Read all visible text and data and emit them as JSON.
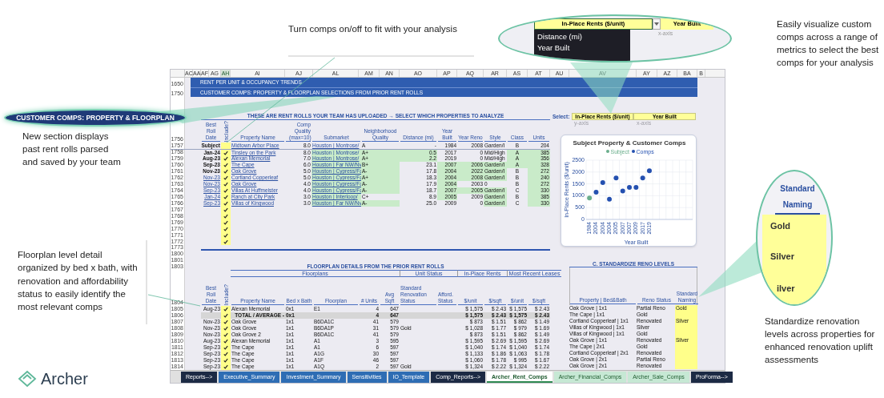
{
  "annotations": {
    "section_label": "CUSTOMER COMPS: PROPERTY & FLOORPLAN",
    "new_section_note": "New section displays past rent rolls parsed and saved by your team",
    "comps_toggle_note": "Turn comps on/off to fit with your analysis",
    "visualize_note": "Easily visualize custom comps across a range of metrics to select the best comps for your analysis",
    "floorplan_note": "Floorplan level detail organized by bed x bath, with renovation and affordability status to easily identify the most relevant comps",
    "standardize_note": "Standardize renovation levels across properties for enhanced renovation uplift assessments"
  },
  "axis_callout": {
    "y_field": "In-Place Rents ($/unit)",
    "x_field": "Year Built",
    "x_hint": "x-axis",
    "menu": [
      "Distance (mi)",
      "Year Built"
    ]
  },
  "naming_callout": {
    "header": "Standard Naming",
    "values": [
      "Gold",
      "Silver",
      "ilver"
    ]
  },
  "logo": {
    "name": "Archer"
  },
  "sheet": {
    "columns": [
      "AC",
      "AA",
      "AF",
      "AG",
      "AH",
      "AI",
      "AJ",
      "AL",
      "AM",
      "AN",
      "AO",
      "AP",
      "AQ",
      "AR",
      "AS",
      "AT",
      "AU",
      "AV",
      "AY",
      "AZ",
      "BA",
      "B"
    ],
    "banners": [
      {
        "row": "1650",
        "text": "RENT PER UNIT & OCCUPANCY TRENDS"
      },
      {
        "row": "1750",
        "text": "CUSTOMER COMPS: PROPERTY & FLOORPLAN SELECTIONS FROM PRIOR RENT ROLLS"
      }
    ],
    "comps": {
      "title": "THESE ARE RENT ROLLS YOUR TEAM HAS UPLOADED  →  SELECT WHICH PROPERTIES TO ANALYZE",
      "header_row": "1756",
      "headers": [
        "Best Roll Date",
        "Include?",
        "Property Name",
        "Comp Quality (max=10)",
        "Submarket",
        "Neighborhood Quality",
        "Distance (mi)",
        "Year Built",
        "Year Reno",
        "Style",
        "Class",
        "Units"
      ],
      "rows": [
        {
          "row": "1757",
          "date": "Subject",
          "linked": false,
          "included": false,
          "property": "Midtown Arbor Place",
          "quality": "8.0",
          "submarket": "Houston | Montrose/",
          "neighborhood": "A",
          "distance": "-",
          "year_built": "1984",
          "year_reno": "2008",
          "style": "Garden/I",
          "class": "B",
          "units": "204",
          "highlighted": [
            false,
            false,
            false,
            false,
            false,
            false,
            false,
            false,
            false,
            false
          ]
        },
        {
          "row": "1758",
          "date": "Jan-24",
          "linked": false,
          "included": true,
          "property": "Tinsley on the Park",
          "quality": "8.0",
          "submarket": "Houston | Montrose/",
          "neighborhood": "A+",
          "distance": "0.5",
          "year_built": "2017",
          "year_reno": "0",
          "style": "Mid/High",
          "class": "A",
          "units": "385",
          "highlighted": [
            false,
            false,
            true,
            true,
            true,
            false,
            false,
            false,
            true,
            true
          ]
        },
        {
          "row": "1759",
          "date": "Aug-23",
          "linked": false,
          "included": true,
          "property": "Alexan Memorial",
          "quality": "7.0",
          "submarket": "Houston | Montrose/",
          "neighborhood": "A+",
          "distance": "2.2",
          "year_built": "2019",
          "year_reno": "0",
          "style": "Mid/High",
          "class": "A",
          "units": "356",
          "highlighted": [
            false,
            false,
            true,
            true,
            true,
            false,
            false,
            false,
            true,
            true
          ]
        },
        {
          "row": "1760",
          "date": "Sep-23",
          "linked": false,
          "included": true,
          "property": "The Cape",
          "quality": "6.0",
          "submarket": "Houston | Far NW/Nv",
          "neighborhood": "B+",
          "distance": "23.1",
          "year_built": "2007",
          "year_reno": "2006",
          "style": "Garden/I",
          "class": "A",
          "units": "328",
          "highlighted": [
            false,
            false,
            true,
            true,
            false,
            true,
            true,
            true,
            true,
            true
          ]
        },
        {
          "row": "1761",
          "date": "Nov-23",
          "linked": false,
          "included": true,
          "property": "Oak Grove",
          "quality": "5.0",
          "submarket": "Houston | Cypress/Fa",
          "neighborhood": "A-",
          "distance": "17.8",
          "year_built": "2004",
          "year_reno": "2022",
          "style": "Garden/I",
          "class": "B",
          "units": "272",
          "highlighted": [
            false,
            false,
            true,
            true,
            false,
            true,
            true,
            true,
            false,
            true
          ]
        },
        {
          "row": "1762",
          "date": "Nov-23",
          "linked": true,
          "included": true,
          "property": "Cortland Copperleaf",
          "quality": "5.0",
          "submarket": "Houston | Cypress/Fa",
          "neighborhood": "A+",
          "distance": "18.3",
          "year_built": "2004",
          "year_reno": "2008",
          "style": "Garden/I",
          "class": "B",
          "units": "240",
          "highlighted": [
            false,
            false,
            true,
            true,
            false,
            true,
            true,
            true,
            false,
            true
          ]
        },
        {
          "row": "1763",
          "date": "Nov-23",
          "linked": true,
          "included": true,
          "property": "Oak Grove",
          "quality": "4.0",
          "submarket": "Houston | Cypress/Fa",
          "neighborhood": "A-",
          "distance": "17.9",
          "year_built": "2004",
          "year_reno": "2003",
          "style": "0",
          "class": "B",
          "units": "272",
          "highlighted": [
            false,
            false,
            true,
            true,
            false,
            true,
            false,
            false,
            false,
            true
          ]
        },
        {
          "row": "1764",
          "date": "Sep-23",
          "linked": true,
          "included": true,
          "property": "Villas At Huffmeister",
          "quality": "4.0",
          "submarket": "Houston | Cypress/Fa",
          "neighborhood": "A-",
          "distance": "18.7",
          "year_built": "2007",
          "year_reno": "2005",
          "style": "Garden/I",
          "class": "C",
          "units": "330",
          "highlighted": [
            false,
            false,
            true,
            true,
            false,
            true,
            true,
            true,
            false,
            true
          ]
        },
        {
          "row": "1765",
          "date": "Jan-24",
          "linked": true,
          "included": true,
          "property": "Ranch at City Park",
          "quality": "3.0",
          "submarket": "Houston | Interloop/",
          "neighborhood": "C+",
          "distance": "8.9",
          "year_built": "2005",
          "year_reno": "2009",
          "style": "Garden/I",
          "class": "B",
          "units": "385",
          "highlighted": [
            false,
            false,
            true,
            false,
            false,
            true,
            false,
            true,
            false,
            true
          ]
        },
        {
          "row": "1766",
          "date": "Sep-23",
          "linked": true,
          "included": true,
          "property": "Villas of Kingwood",
          "quality": "3.0",
          "submarket": "Houston | Far NW/Nv",
          "neighborhood": "A-",
          "distance": "25.0",
          "year_built": "2009",
          "year_reno": "0",
          "style": "Garden/I",
          "class": "C",
          "units": "330",
          "highlighted": [
            false,
            false,
            true,
            true,
            false,
            false,
            false,
            true,
            false,
            true
          ]
        }
      ],
      "blank_rows": [
        {
          "row": "1767",
          "included": true
        },
        {
          "row": "1768",
          "included": true
        },
        {
          "row": "1769",
          "included": true
        },
        {
          "row": "1770",
          "included": true
        },
        {
          "row": "1771",
          "included": true
        },
        {
          "row": "1772",
          "included": true
        }
      ]
    },
    "rule_row": "1773",
    "spacer_rows": [
      "1800",
      "1801"
    ],
    "floorplans": {
      "title_row": "1803",
      "title": "FLOORPLAN DETAILS FROM THE PRIOR RENT ROLLS",
      "groups": [
        "Floorplans",
        "Unit Status",
        "In-Place Rents",
        "Most Recent Leases"
      ],
      "header_row": "1804",
      "headers": [
        "Best Roll Date",
        "Include?",
        "Property Name",
        "Bed x Bath",
        "Floorplan",
        "# Units",
        "Avg Sqft",
        "Standard Renovation Status",
        "Afford. Status",
        "$/unit",
        "$/sqft",
        "$/unit",
        "$/sqft"
      ],
      "rows": [
        {
          "row": "1805",
          "total": false,
          "date": "Aug-23",
          "included": true,
          "property": "Alexan Memorial",
          "bed_bath": "0x1",
          "floorplan": "E1",
          "units": "4",
          "sqft": "647",
          "rent_unit": "$ 1,575",
          "rent_sqft": "$ 2.43",
          "lease_unit": "$ 1,575",
          "lease_sqft": "$ 2.43"
        },
        {
          "row": "1806",
          "total": true,
          "included": true,
          "property": "TOTAL / AVERAGE -",
          "bed_bath": "0x1",
          "units": "4",
          "sqft": "647",
          "rent_unit": "$ 1,575",
          "rent_sqft": "$ 2.43",
          "lease_unit": "$ 1,575",
          "lease_sqft": "$ 2.43"
        },
        {
          "row": "1807",
          "total": false,
          "date": "Nov-23",
          "included": true,
          "property": "Oak Grove",
          "bed_bath": "1x1",
          "floorplan": "B6DA1C",
          "units": "41",
          "sqft": "579",
          "rent_unit": "$ 873",
          "rent_sqft": "$ 1.51",
          "lease_unit": "$ 862",
          "lease_sqft": "$ 1.49"
        },
        {
          "row": "1808",
          "total": false,
          "date": "Nov-23",
          "included": true,
          "property": "Oak Grove",
          "bed_bath": "1x1",
          "floorplan": "B6DA1P",
          "units": "31",
          "sqft": "579",
          "reno": "Gold",
          "rent_unit": "$ 1,028",
          "rent_sqft": "$ 1.77",
          "lease_unit": "$ 979",
          "lease_sqft": "$ 1.69"
        },
        {
          "row": "1809",
          "total": false,
          "date": "Nov-23",
          "included": true,
          "property": "Oak Grove 2",
          "bed_bath": "1x1",
          "floorplan": "B6DA1C",
          "units": "41",
          "sqft": "579",
          "rent_unit": "$ 873",
          "rent_sqft": "$ 1.51",
          "lease_unit": "$ 862",
          "lease_sqft": "$ 1.49"
        },
        {
          "row": "1810",
          "total": false,
          "date": "Aug-23",
          "included": true,
          "property": "Alexan Memorial",
          "bed_bath": "1x1",
          "floorplan": "A1",
          "units": "3",
          "sqft": "595",
          "rent_unit": "$ 1,595",
          "rent_sqft": "$ 2.69",
          "lease_unit": "$ 1,595",
          "lease_sqft": "$ 2.69"
        },
        {
          "row": "1811",
          "total": false,
          "date": "Sep-23",
          "included": true,
          "property": "The Cape",
          "bed_bath": "1x1",
          "floorplan": "A1",
          "units": "6",
          "sqft": "597",
          "rent_unit": "$ 1,040",
          "rent_sqft": "$ 1.74",
          "lease_unit": "$ 1,040",
          "lease_sqft": "$ 1.74"
        },
        {
          "row": "1812",
          "total": false,
          "date": "Sep-23",
          "included": true,
          "property": "The Cape",
          "bed_bath": "1x1",
          "floorplan": "A1G",
          "units": "30",
          "sqft": "597",
          "rent_unit": "$ 1,133",
          "rent_sqft": "$ 1.86",
          "lease_unit": "$ 1,063",
          "lease_sqft": "$ 1.78"
        },
        {
          "row": "1813",
          "total": false,
          "date": "Sep-23",
          "included": true,
          "property": "The Cape",
          "bed_bath": "1x1",
          "floorplan": "A1F",
          "units": "46",
          "sqft": "597",
          "rent_unit": "$ 1,060",
          "rent_sqft": "$ 1.78",
          "lease_unit": "$ 995",
          "lease_sqft": "$ 1.67"
        },
        {
          "row": "1814",
          "total": false,
          "date": "Sep-23",
          "included": true,
          "property": "The Cape",
          "bed_bath": "1x1",
          "floorplan": "A1Q",
          "units": "2",
          "sqft": "597",
          "reno": "Gold",
          "rent_unit": "$ 1,324",
          "rent_sqft": "$ 2.22",
          "lease_unit": "$ 1,324",
          "lease_sqft": "$ 2.22"
        }
      ]
    },
    "selector": {
      "label": "Select:",
      "y_value": "In-Place Rents ($/unit)",
      "x_value": "Year Built",
      "y_hint": "y-axis",
      "x_hint": "x-axis"
    },
    "chart": {
      "chart_data": {
        "type": "scatter",
        "title": "Subject Property & Customer Comps",
        "xlabel": "Year Built",
        "ylabel": "In-Place Rents ($/unit)",
        "categories": [
          "1984",
          "2004",
          "2004",
          "2004",
          "2005",
          "2007",
          "2007",
          "2009",
          "2017",
          "2019"
        ],
        "series": [
          {
            "name": "Subject",
            "color": "#6aae8c",
            "values": [
              900,
              null,
              null,
              null,
              null,
              null,
              null,
              null,
              null,
              null
            ]
          },
          {
            "name": "Comps",
            "color": "#2450b0",
            "values": [
              null,
              1150,
              1550,
              850,
              1750,
              1200,
              1350,
              1350,
              1750,
              2050
            ]
          }
        ],
        "ylim": [
          0,
          2500
        ],
        "yticks": [
          0,
          500,
          1000,
          1500,
          2000,
          2500
        ],
        "grid": true
      }
    },
    "reno": {
      "title": "C. STANDARDIZE RENO LEVELS",
      "headers": [
        "Property | Bed&Bath",
        "Reno Status",
        "Standard Naming"
      ],
      "rows": [
        {
          "property": "Oak Grove | 1x1",
          "status": "Partial Reno",
          "naming": "Gold"
        },
        {
          "property": "The Cape | 1x1",
          "status": "Gold"
        },
        {
          "property": "Cortland Copperleaf | 1x1",
          "status": "Renovated",
          "naming": "Silver"
        },
        {
          "property": "Villas of Kingwood | 1x1",
          "status": "Silver"
        },
        {
          "property": "Villas of Kingwood | 1x1",
          "status": "Gold"
        },
        {
          "property": "Oak Grove | 1x1",
          "status": "Renovated",
          "naming": "Silver"
        },
        {
          "property": "The Cape | 2x1",
          "status": "Gold"
        },
        {
          "property": "Cortland Copperleaf | 2x1",
          "status": "Renovated"
        },
        {
          "property": "Oak Grove | 2x1",
          "status": "Partial Reno"
        },
        {
          "property": "Oak Grove | 2x1",
          "status": "Renovated"
        }
      ]
    },
    "tabs": [
      {
        "label": "Reports-->",
        "selected": false,
        "color": "#1c2a44"
      },
      {
        "label": "Executive_Summary",
        "selected": false,
        "color": "#2e6db4"
      },
      {
        "label": "Investment_Summary",
        "selected": false,
        "color": "#2e6db4"
      },
      {
        "label": "Sensitivities",
        "selected": false,
        "color": "#2e6db4"
      },
      {
        "label": "IO_Template",
        "selected": false,
        "color": "#2e6db4"
      },
      {
        "label": "Comp_Reports-->",
        "selected": false,
        "color": "#1c2a44"
      },
      {
        "label": "Archer_Rent_Comps",
        "selected": true,
        "color": "#ffffff"
      },
      {
        "label": "Archer_Financial_Comps",
        "selected": false,
        "color": "#c6e8d4"
      },
      {
        "label": "Archer_Sale_Comps",
        "selected": false,
        "color": "#c6e8d4"
      },
      {
        "label": "ProForma-->",
        "selected": false,
        "color": "#1c2a44"
      }
    ]
  }
}
